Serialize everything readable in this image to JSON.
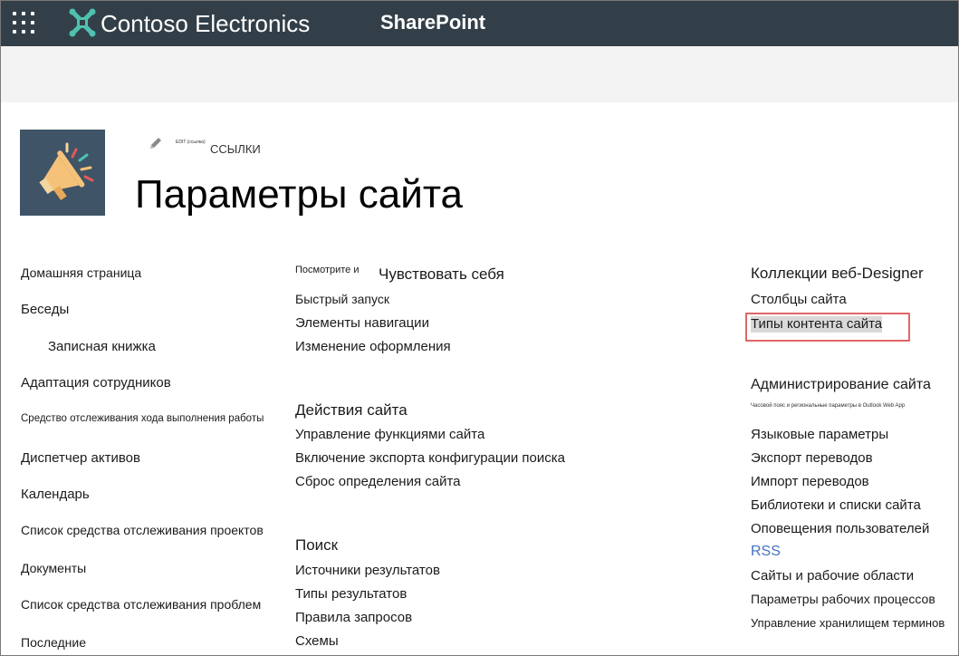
{
  "suitebar": {
    "brand": "Contoso Electronics",
    "app": "SharePoint",
    "bg_color": "#333f48",
    "brand_logo_color": "#4fc1b0"
  },
  "site": {
    "edit_tiny": "EDIT (ссылка)",
    "links_label": "ССЫЛКИ",
    "title": "Параметры сайта"
  },
  "col1": {
    "items": [
      "Домашняя страница",
      "Беседы",
      "Записная книжка",
      "Адаптация сотрудников",
      "Средство отслеживания хода выполнения работы",
      "Диспетчер активов",
      "Календарь",
      "Список средства отслеживания проектов",
      "Документы",
      "Список средства отслеживания проблем",
      "Последние"
    ]
  },
  "col2": {
    "look_prefix": "Посмотрите и",
    "look_heading": "Чувствовать себя",
    "look_items": [
      "Быстрый запуск",
      "Элементы навигации",
      "Изменение оформления"
    ],
    "actions_heading": "Действия сайта",
    "actions_items": [
      "Управление функциями сайта",
      "Включение экспорта конфигурации поиска",
      "Сброс определения сайта"
    ],
    "search_heading": "Поиск",
    "search_items": [
      "Источники результатов",
      "Типы результатов",
      "Правила запросов",
      "Схемы"
    ]
  },
  "col3": {
    "gallery_heading": "Коллекции веб-Designer",
    "gallery_items": [
      "Столбцы сайта",
      "Типы контента сайта"
    ],
    "admin_heading": "Администрирование сайта",
    "admin_tiny": "Часовой пояс и региональные параметры в Outlook Web App",
    "admin_items": [
      "Языковые параметры",
      "Экспорт переводов",
      "Импорт переводов",
      "Библиотеки и списки сайта",
      "Оповещения пользователей",
      "RSS",
      "Сайты и рабочие области",
      "Параметры рабочих процессов",
      "Управление хранилищем терминов"
    ],
    "highlight_color": "#e06666",
    "rss_color": "#4472c4"
  }
}
